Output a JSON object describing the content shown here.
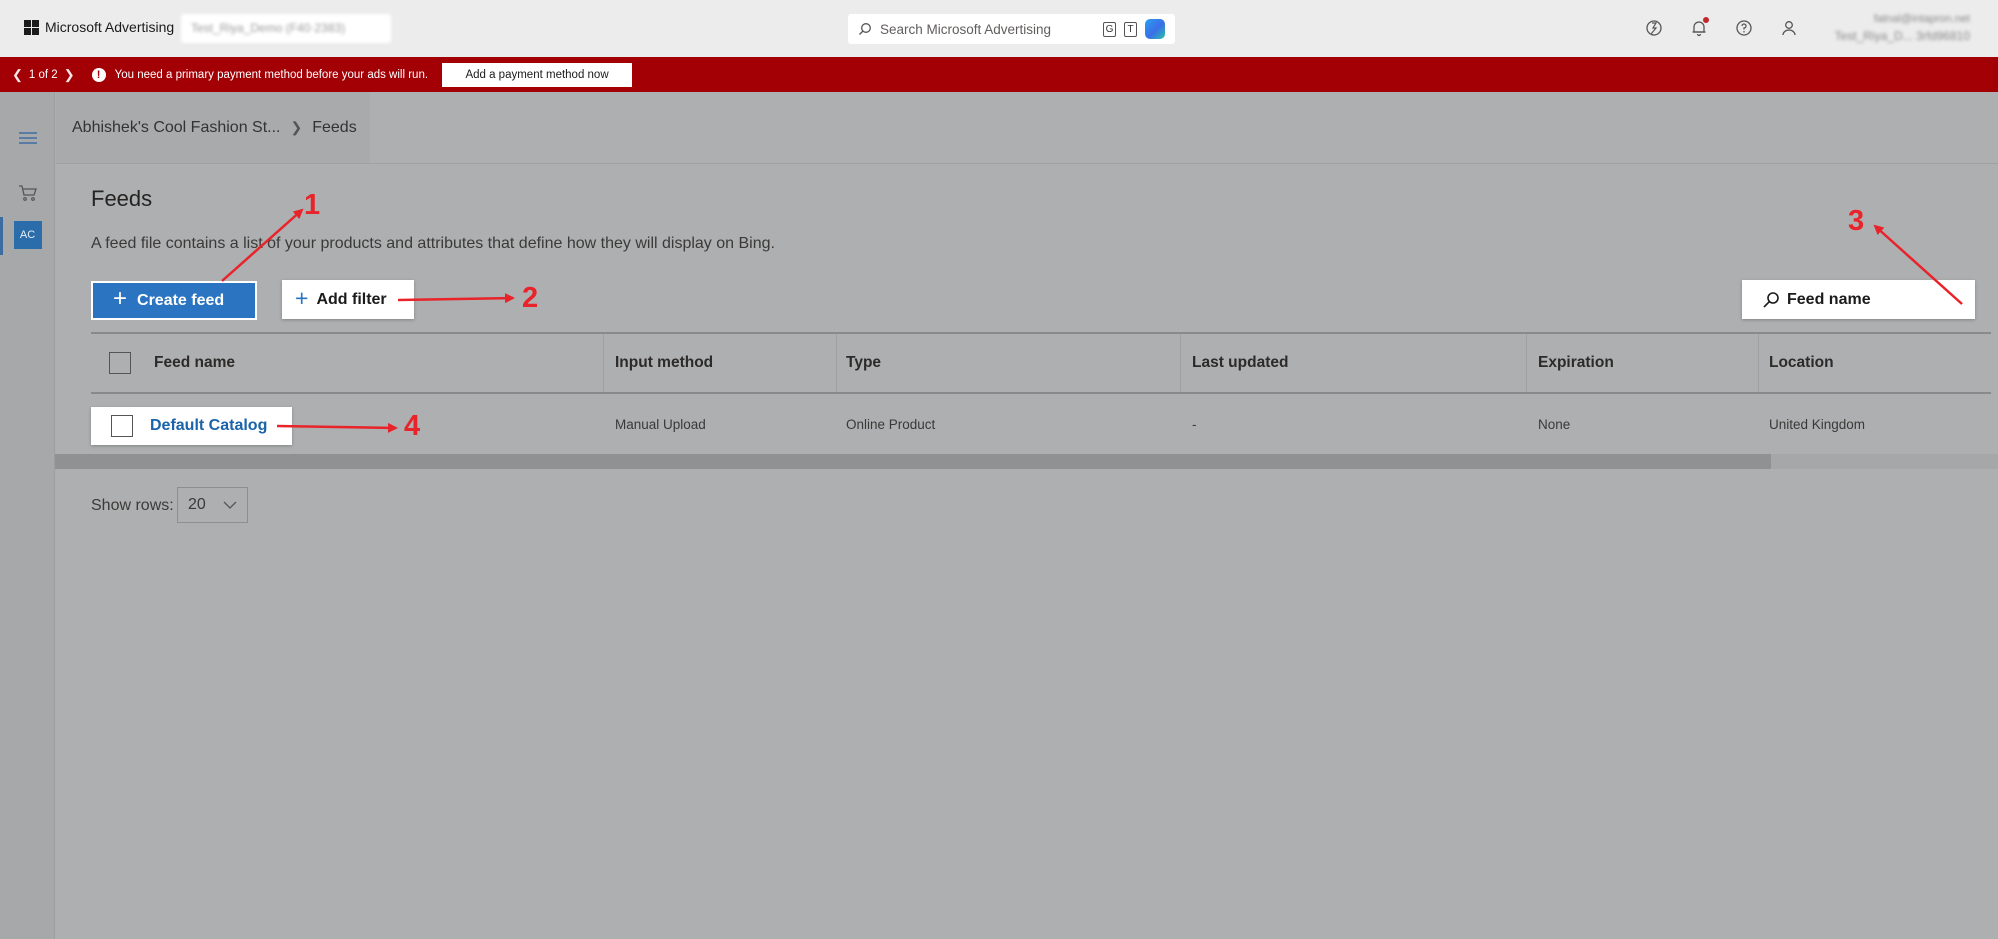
{
  "topbar": {
    "brand": "Microsoft Advertising",
    "account": "Test_Riya_Demo (F40·2383)",
    "search_placeholder": "Search Microsoft Advertising",
    "kbd_g": "G",
    "kbd_t": "T",
    "user_email": "fatnal@intapron.net",
    "user_name": "Test_Riya_D...  3rfd96810"
  },
  "banner": {
    "pager": "1 of 2",
    "message": "You need a primary payment method before your ads will run.",
    "action_label": "Add a payment method now",
    "color": "#a30006"
  },
  "rail": {
    "account_badge": "AC"
  },
  "breadcrumb": {
    "account": "Abhishek's Cool Fashion St...",
    "current": "Feeds"
  },
  "page": {
    "title": "Feeds",
    "description": "A feed file contains a list of your products and attributes that define how they will display on Bing."
  },
  "toolbar": {
    "create_label": "Create feed",
    "filter_label": "Add filter",
    "search_label": "Feed name"
  },
  "table": {
    "columns": [
      "Feed name",
      "Input method",
      "Type",
      "Last updated",
      "Expiration",
      "Location"
    ],
    "rows": [
      {
        "feed_name": "Default Catalog",
        "input_method": "Manual Upload",
        "type": "Online Product",
        "last_updated": "-",
        "expiration": "None",
        "location": "United Kingdom"
      }
    ]
  },
  "pagination": {
    "show_rows_label": "Show rows:",
    "rows_value": "20"
  },
  "annotations": {
    "a1": "1",
    "a2": "2",
    "a3": "3",
    "a4": "4",
    "color": "#e8232a"
  }
}
